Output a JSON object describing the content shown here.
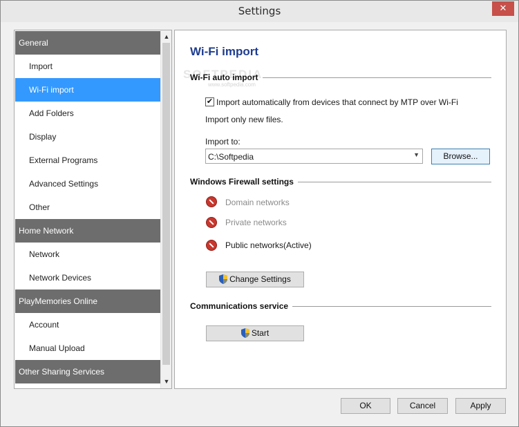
{
  "window": {
    "title": "Settings",
    "close_glyph": "✕"
  },
  "sidebar": {
    "items": [
      {
        "label": "General",
        "kind": "header"
      },
      {
        "label": "Import",
        "kind": "item"
      },
      {
        "label": "Wi-Fi import",
        "kind": "selected"
      },
      {
        "label": "Add Folders",
        "kind": "item"
      },
      {
        "label": "Display",
        "kind": "item"
      },
      {
        "label": "External Programs",
        "kind": "item"
      },
      {
        "label": "Advanced Settings",
        "kind": "item"
      },
      {
        "label": "Other",
        "kind": "item"
      },
      {
        "label": "Home Network",
        "kind": "header"
      },
      {
        "label": "Network",
        "kind": "item"
      },
      {
        "label": "Network Devices",
        "kind": "item"
      },
      {
        "label": "PlayMemories Online",
        "kind": "header"
      },
      {
        "label": "Account",
        "kind": "item"
      },
      {
        "label": "Manual Upload",
        "kind": "item"
      },
      {
        "label": "Other Sharing Services",
        "kind": "header"
      }
    ],
    "scroll_up": "▲",
    "scroll_down": "▼"
  },
  "content": {
    "page_title": "Wi-Fi import",
    "wifi_auto_import": {
      "heading": "Wi-Fi auto import",
      "auto_import_checked": true,
      "auto_import_label": "Import automatically from devices that connect by MTP over Wi-Fi",
      "new_files_note": "Import only new files.",
      "import_to_label": "Import to:",
      "import_to_value": "C:\\Softpedia",
      "browse_label": "Browse..."
    },
    "firewall": {
      "heading": "Windows Firewall settings",
      "domain_label": "Domain networks",
      "private_label": "Private networks",
      "public_label": "Public networks(Active)",
      "change_settings_label": "Change Settings"
    },
    "communications": {
      "heading": "Communications service",
      "start_label": "Start"
    },
    "watermark": "SOFTPEDIA",
    "watermark_sub": "www.softpedia.com"
  },
  "footer": {
    "ok_label": "OK",
    "cancel_label": "Cancel",
    "apply_label": "Apply"
  },
  "colors": {
    "header_bg": "#6d6d6d",
    "selected_bg": "#3399ff",
    "title_blue": "#1e3d8f",
    "blocked_red": "#c8372d"
  },
  "icons": {
    "checkbox_check": "✔",
    "select_arrow": "▼"
  }
}
